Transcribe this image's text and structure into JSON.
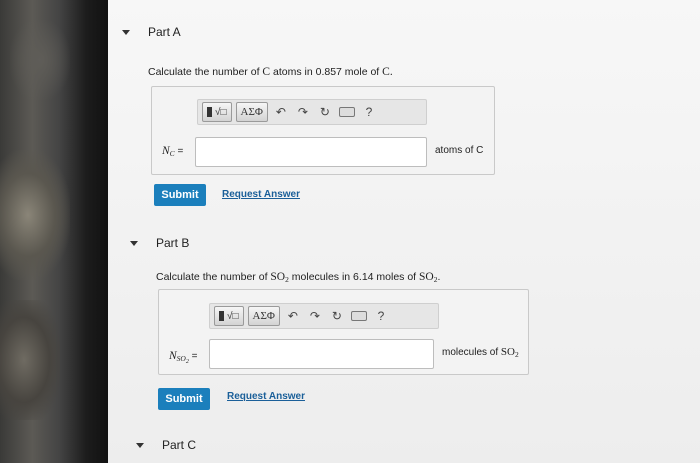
{
  "partA": {
    "header": "Part A",
    "question_prefix": "Calculate the number of",
    "question_atom": "C",
    "question_mid": "atoms in 0.857 mole of",
    "question_end": "C.",
    "toolbar": {
      "sqrt_label": "√□",
      "greek_label": "ΑΣΦ",
      "help_label": "?"
    },
    "variable": "N",
    "variable_sub": "C",
    "equals": " =",
    "input_value": "",
    "units": "atoms of C",
    "submit_label": "Submit",
    "request_label": "Request Answer"
  },
  "partB": {
    "header": "Part B",
    "question_prefix": "Calculate the number of",
    "question_formula": "SO",
    "question_formula_sub": "2",
    "question_mid": "molecules in 6.14 moles of",
    "question_formula2": "SO",
    "question_formula2_sub": "2",
    "question_end": ".",
    "toolbar": {
      "sqrt_label": "√□",
      "greek_label": "ΑΣΦ",
      "help_label": "?"
    },
    "variable": "N",
    "variable_sub": "SO",
    "variable_sub2": "2",
    "equals": " =",
    "input_value": "",
    "units_prefix": "molecules of",
    "units_formula": "SO",
    "units_formula_sub": "2",
    "submit_label": "Submit",
    "request_label": "Request Answer"
  },
  "partC": {
    "header": "Part C"
  },
  "colors": {
    "submit": "#1b7fbc",
    "link": "#1a5f99"
  }
}
